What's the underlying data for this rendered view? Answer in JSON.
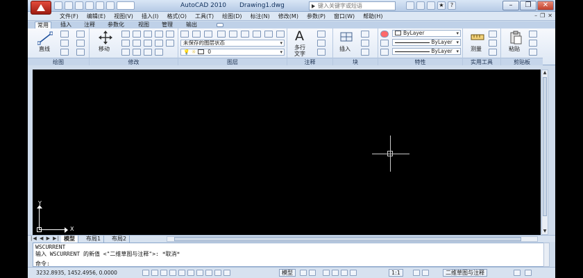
{
  "title_bar": {
    "app_title": "AutoCAD 2010",
    "file_name": "Drawing1.dwg",
    "search_placeholder": "键入关键字或短语"
  },
  "menu": {
    "items": [
      "文件(F)",
      "编辑(E)",
      "视图(V)",
      "插入(I)",
      "格式(O)",
      "工具(T)",
      "绘图(D)",
      "标注(N)",
      "修改(M)",
      "参数(P)",
      "窗口(W)",
      "帮助(H)"
    ]
  },
  "ribbon_tabs": [
    "常用",
    "插入",
    "注释",
    "参数化",
    "视图",
    "管理",
    "输出"
  ],
  "ribbon": {
    "panels": {
      "draw": "绘图",
      "modify": "修改",
      "layers": "图层",
      "annotation": "注释",
      "block": "块",
      "properties": "特性",
      "utilities": "实用工具",
      "clipboard": "剪贴板"
    },
    "labels": {
      "line": "直线",
      "move": "移动",
      "multiline_text": "多行",
      "text": "文字",
      "insert": "插入",
      "measure": "测量",
      "paste": "粘贴"
    },
    "layer_state": "未保存的图层状态",
    "layer_current": "0",
    "bylayer": "ByLayer"
  },
  "drawing": {
    "ucs_x": "X",
    "ucs_y": "Y"
  },
  "layout_tabs": [
    "模型",
    "布局1",
    "布局2"
  ],
  "command_line": {
    "line1": "WSCURRENT",
    "line2": "输入 WSCURRENT 的新值 <\"二维草图与注释\">: *取消*",
    "prompt": "命令:"
  },
  "status_bar": {
    "coordinates": "3232.8935, 1452.4956, 0.0000",
    "model_label": "模型",
    "scale": "1:1",
    "workspace": "二维草图与注释"
  }
}
